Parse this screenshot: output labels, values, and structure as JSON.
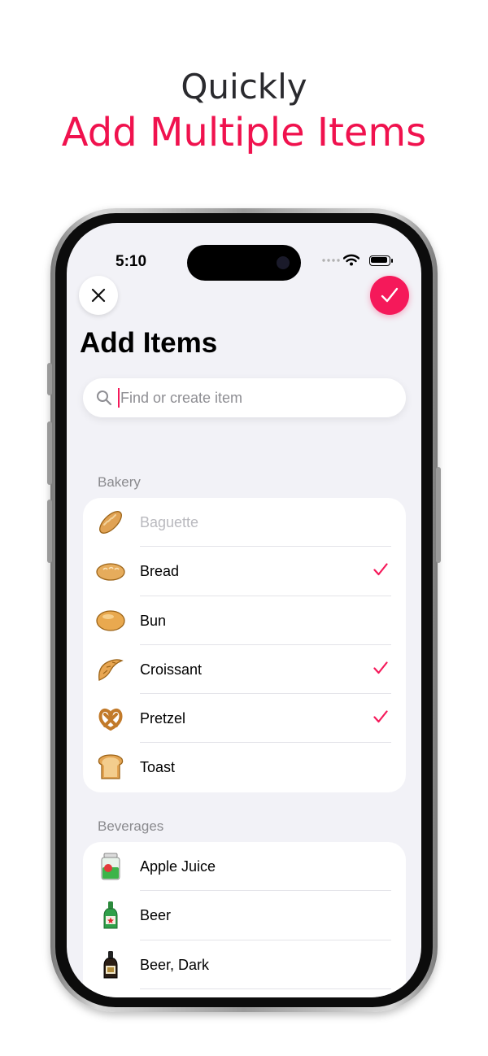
{
  "promo": {
    "line1": "Quickly",
    "line2": "Add Multiple Items"
  },
  "status_bar": {
    "time": "5:10"
  },
  "header": {
    "title": "Add Items"
  },
  "search": {
    "placeholder": "Find or create item",
    "value": ""
  },
  "colors": {
    "accent": "#f5195a",
    "promo_accent": "#f0124e",
    "background": "#f2f2f7"
  },
  "sections": [
    {
      "label": "Bakery",
      "items": [
        {
          "label": "Baguette",
          "icon": "baguette-icon",
          "checked": false,
          "dimmed": true
        },
        {
          "label": "Bread",
          "icon": "bread-icon",
          "checked": true,
          "dimmed": false
        },
        {
          "label": "Bun",
          "icon": "bun-icon",
          "checked": false,
          "dimmed": false
        },
        {
          "label": "Croissant",
          "icon": "croissant-icon",
          "checked": true,
          "dimmed": false
        },
        {
          "label": "Pretzel",
          "icon": "pretzel-icon",
          "checked": true,
          "dimmed": false
        },
        {
          "label": "Toast",
          "icon": "toast-icon",
          "checked": false,
          "dimmed": false
        }
      ]
    },
    {
      "label": "Beverages",
      "items": [
        {
          "label": "Apple Juice",
          "icon": "apple-juice-icon",
          "checked": false,
          "dimmed": false
        },
        {
          "label": "Beer",
          "icon": "beer-icon",
          "checked": false,
          "dimmed": false
        },
        {
          "label": "Beer, Dark",
          "icon": "dark-beer-icon",
          "checked": false,
          "dimmed": false
        }
      ]
    }
  ]
}
